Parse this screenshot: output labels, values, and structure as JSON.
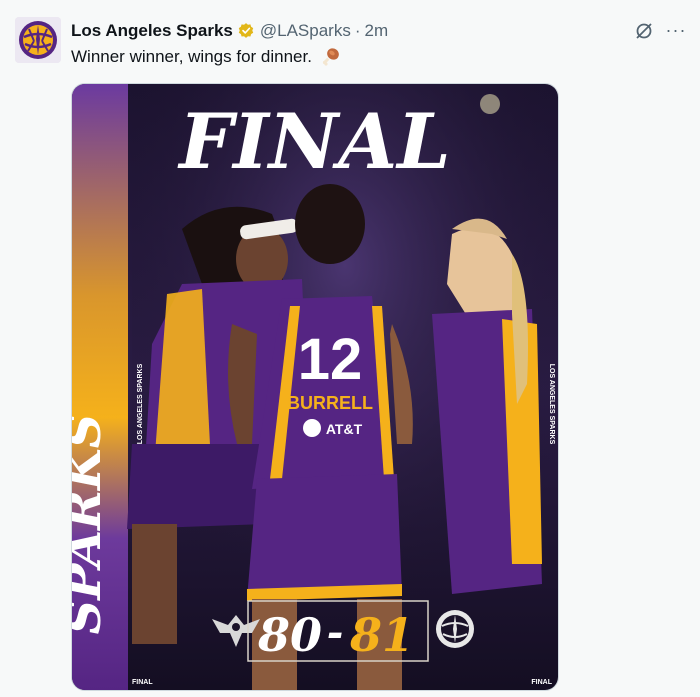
{
  "tweet": {
    "author_name": "Los Angeles Sparks",
    "handle": "@LASparks",
    "separator": "·",
    "time": "2m",
    "text": "Winner winner, wings for dinner.",
    "emoji": "drumstick-emoji",
    "verified": "gold-verified-badge"
  },
  "actions": {
    "grok_icon": "grok-slash-icon",
    "more_label": "···"
  },
  "media": {
    "headline": "FINAL",
    "side_brand": "SPARKS",
    "side_small_left": "LOS ANGELES SPARKS",
    "side_small_right": "LOS ANGELES SPARKS",
    "jersey_number": "12",
    "jersey_name": "BURRELL",
    "jersey_sponsor": "AT&T",
    "score_home": "80",
    "score_dash": "-",
    "score_away": "81",
    "footer_left": "FINAL",
    "footer_right": "FINAL",
    "left_team_logo": "wings-logo",
    "right_team_logo": "sparks-logo"
  },
  "colors": {
    "purple": "#552583",
    "gold": "#f5b11b",
    "text_primary": "#0f1419",
    "text_secondary": "#536471"
  }
}
